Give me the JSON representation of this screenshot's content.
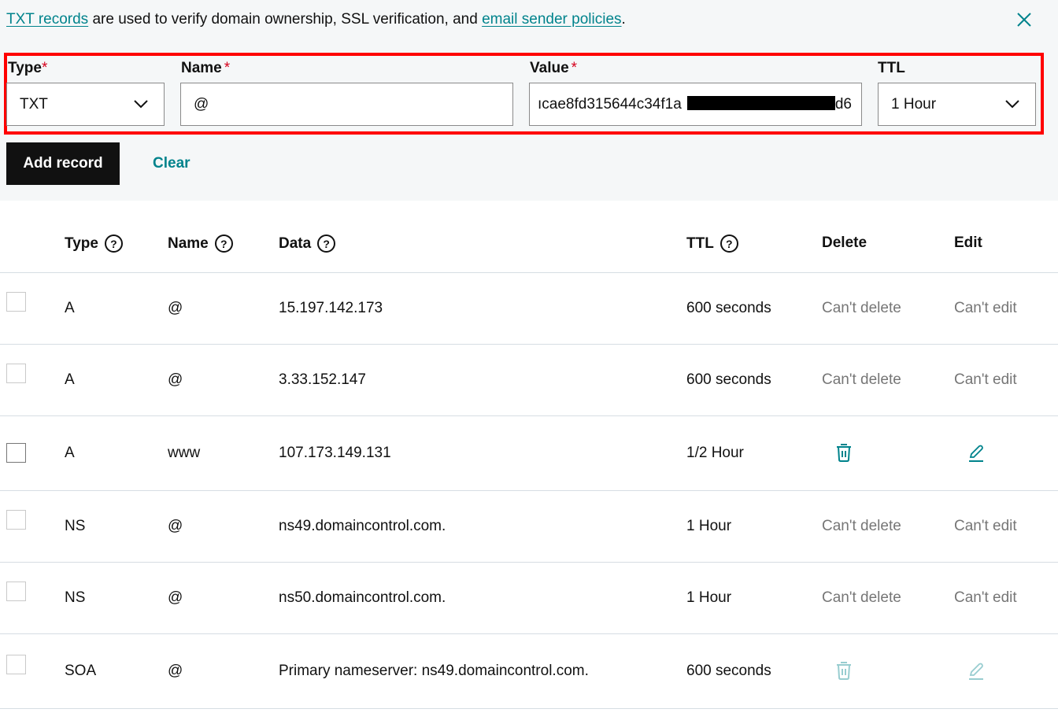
{
  "info": {
    "link1": "TXT records",
    "middle": " are used to verify domain ownership, SSL verification, and ",
    "link2": "email sender policies",
    "end": "."
  },
  "form": {
    "type_label": "Type",
    "type_value": "TXT",
    "name_label": "Name",
    "name_value": "@",
    "value_label": "Value",
    "value_prefix": "ıcae8fd315644c34f1a",
    "value_suffix": "d6",
    "ttl_label": "TTL",
    "ttl_value": "1 Hour",
    "required_mark": "*"
  },
  "actions": {
    "add_record": "Add record",
    "clear": "Clear"
  },
  "colors": {
    "accent": "#00838c",
    "highlight": "#ff0000",
    "required": "#d6001c"
  },
  "table": {
    "headers": {
      "type": "Type",
      "name": "Name",
      "data": "Data",
      "ttl": "TTL",
      "delete": "Delete",
      "edit": "Edit"
    },
    "help_glyph": "?",
    "rows": [
      {
        "type": "A",
        "name": "@",
        "data": "15.197.142.173",
        "ttl": "600 seconds",
        "delete": "Can't delete",
        "edit": "Can't edit"
      },
      {
        "type": "A",
        "name": "@",
        "data": "3.33.152.147",
        "ttl": "600 seconds",
        "delete": "Can't delete",
        "edit": "Can't edit"
      },
      {
        "type": "A",
        "name": "www",
        "data": "107.173.149.131",
        "ttl": "1/2 Hour",
        "delete": "trash-icon",
        "edit": "pencil-icon"
      },
      {
        "type": "NS",
        "name": "@",
        "data": "ns49.domaincontrol.com.",
        "ttl": "1 Hour",
        "delete": "Can't delete",
        "edit": "Can't edit"
      },
      {
        "type": "NS",
        "name": "@",
        "data": "ns50.domaincontrol.com.",
        "ttl": "1 Hour",
        "delete": "Can't delete",
        "edit": "Can't edit"
      },
      {
        "type": "SOA",
        "name": "@",
        "data": "Primary nameserver: ns49.domaincontrol.com.",
        "ttl": "600 seconds",
        "delete": "trash-icon-disabled",
        "edit": "pencil-icon-disabled"
      }
    ]
  }
}
